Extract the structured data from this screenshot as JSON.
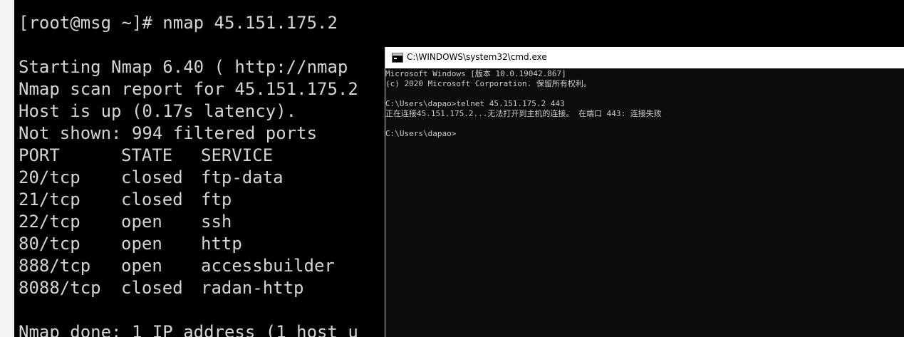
{
  "ssh_terminal": {
    "prompt_line": "[root@msg ~]# nmap 45.151.175.2",
    "lines": [
      "Starting Nmap 6.40 ( http://nmap",
      "Nmap scan report for 45.151.175.2",
      "Host is up (0.17s latency).",
      "Not shown: 994 filtered ports"
    ],
    "table_header": {
      "port": "PORT",
      "state": "STATE",
      "service": "SERVICE"
    },
    "ports": [
      {
        "port": "20/tcp",
        "state": "closed",
        "service": "ftp-data"
      },
      {
        "port": "21/tcp",
        "state": "closed",
        "service": "ftp"
      },
      {
        "port": "22/tcp",
        "state": "open",
        "service": "ssh"
      },
      {
        "port": "80/tcp",
        "state": "open",
        "service": "http"
      },
      {
        "port": "888/tcp",
        "state": "open",
        "service": "accessbuilder"
      },
      {
        "port": "8088/tcp",
        "state": "closed",
        "service": "radan-http"
      }
    ],
    "done_line": "Nmap done: 1 IP address (1 host u"
  },
  "cmd_window": {
    "title": "C:\\WINDOWS\\system32\\cmd.exe",
    "lines": [
      "Microsoft Windows [版本 10.0.19042.867]",
      "(c) 2020 Microsoft Corporation. 保留所有权利。",
      "",
      "C:\\Users\\dapao>telnet 45.151.175.2 443",
      "正在连接45.151.175.2...无法打开到主机的连接。 在端口 443: 连接失败",
      "",
      "C:\\Users\\dapao>"
    ]
  },
  "colors": {
    "terminal_bg": "#000000",
    "terminal_text": "#d4d4d4",
    "cmd_bg": "#0c0c0c",
    "cmd_text": "#cccccc",
    "titlebar_bg": "#ffffff"
  }
}
